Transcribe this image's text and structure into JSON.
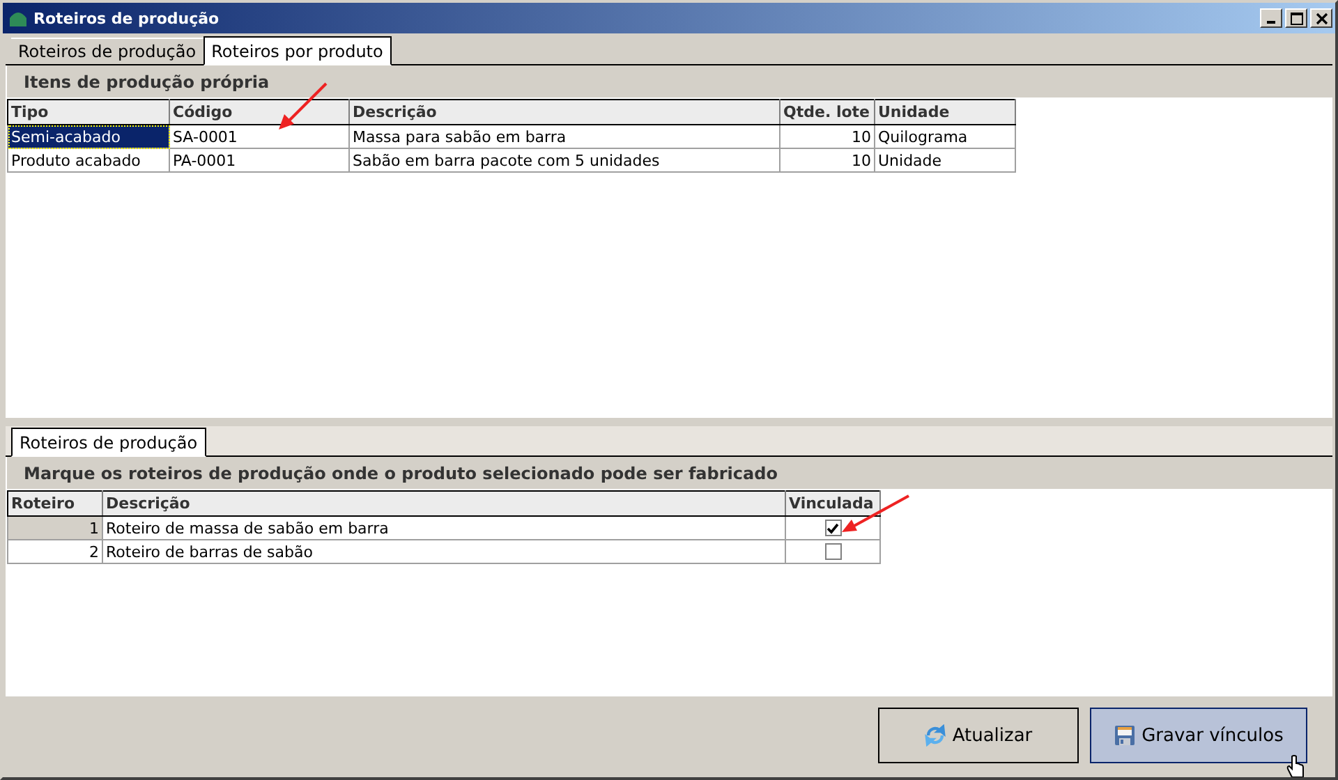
{
  "window": {
    "title": "Roteiros de produção"
  },
  "tabs": [
    {
      "label": "Roteiros de produção",
      "selected": false
    },
    {
      "label": "Roteiros por produto",
      "selected": true
    }
  ],
  "products": {
    "title": "Itens de produção própria",
    "columns": [
      "Tipo",
      "Código",
      "Descrição",
      "Qtde. lote",
      "Unidade"
    ],
    "rows": [
      {
        "cells": [
          "Semi-acabado",
          "SA-0001",
          "Massa para sabão em barra",
          "10",
          "Quilograma"
        ],
        "selected": true
      },
      {
        "cells": [
          "Produto acabado",
          "PA-0001",
          "Sabão em barra pacote com 5 unidades",
          "10",
          "Unidade"
        ],
        "selected": false
      }
    ]
  },
  "lower_tabs": [
    {
      "label": "Roteiros de produção",
      "selected": true
    }
  ],
  "routes": {
    "title": "Marque os roteiros de produção onde o produto selecionado pode ser fabricado",
    "columns": [
      "Roteiro",
      "Descrição",
      "Vinculada"
    ],
    "rows": [
      {
        "number": "1",
        "description": "Roteiro de massa de sabão em barra",
        "checked": true,
        "selected": true
      },
      {
        "number": "2",
        "description": "Roteiro de barras de sabão",
        "checked": false,
        "selected": false
      }
    ]
  },
  "buttons": [
    {
      "label": "Atualizar",
      "kind": "refresh",
      "highlighted": false
    },
    {
      "label": "Gravar vínculos",
      "kind": "save",
      "highlighted": true
    }
  ]
}
